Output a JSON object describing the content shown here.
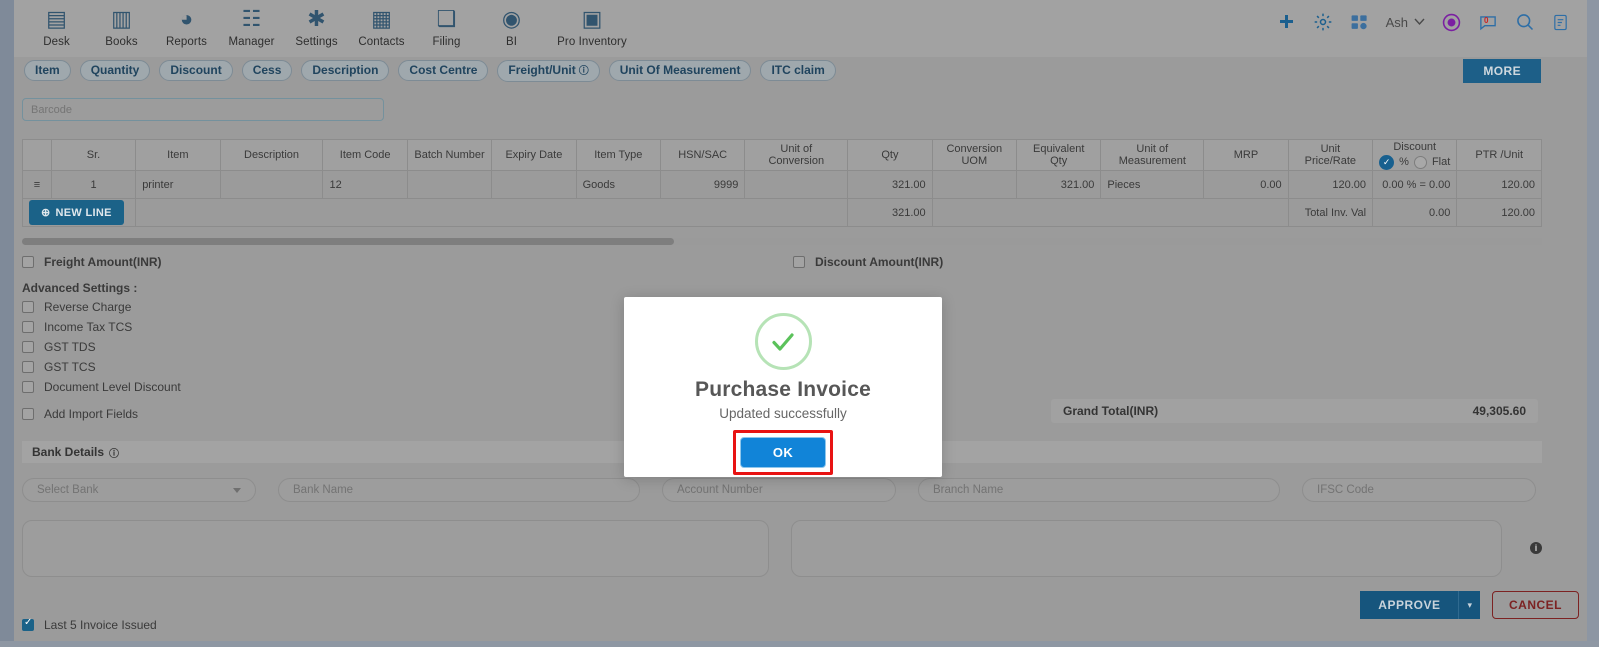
{
  "topnav": {
    "items": [
      {
        "label": "Desk",
        "icon": "desk-analytics-icon",
        "glyph": "▤"
      },
      {
        "label": "Books",
        "icon": "books-icon",
        "glyph": "▥"
      },
      {
        "label": "Reports",
        "icon": "reports-pie-icon",
        "glyph": "◕"
      },
      {
        "label": "Manager",
        "icon": "manager-people-icon",
        "glyph": "☷"
      },
      {
        "label": "Settings",
        "icon": "settings-tools-icon",
        "glyph": "✱"
      },
      {
        "label": "Contacts",
        "icon": "contacts-icon",
        "glyph": "▦"
      },
      {
        "label": "Filing",
        "icon": "filing-icon",
        "glyph": "❑"
      },
      {
        "label": "BI",
        "icon": "bi-icon",
        "glyph": "◉"
      },
      {
        "label": "Pro Inventory",
        "icon": "pro-inventory-icon",
        "glyph": "▣"
      }
    ],
    "right": {
      "add_icon": "plus-icon",
      "settings_icon": "gear-icon",
      "apps_icon": "apps-grid-icon",
      "user_label": "Ash",
      "chevron_icon": "chevron-down-icon",
      "badge_icon": "new-badge-icon",
      "messages_icon": "chat-bubble-icon",
      "messages_count": "0",
      "search_icon": "search-icon",
      "notes_icon": "notes-icon"
    }
  },
  "chips": [
    {
      "label": "Item"
    },
    {
      "label": "Quantity"
    },
    {
      "label": "Discount"
    },
    {
      "label": "Cess"
    },
    {
      "label": "Description"
    },
    {
      "label": "Cost Centre"
    },
    {
      "label": "Freight/Unit",
      "info": true
    },
    {
      "label": "Unit Of Measurement"
    },
    {
      "label": "ITC claim"
    }
  ],
  "more_button": "MORE",
  "barcode": {
    "placeholder": "Barcode",
    "value": ""
  },
  "grid": {
    "headers": [
      "",
      "Sr.",
      "Item",
      "Description",
      "Item Code",
      "Batch Number",
      "Expiry Date",
      "Item Type",
      "HSN/SAC",
      "Unit of Conversion",
      "Qty",
      "Conversion UOM",
      "Equivalent Qty",
      "Unit of Measurement",
      "MRP",
      "Unit Price/Rate",
      "Discount",
      "PTR /Unit"
    ],
    "discount_header": {
      "title": "Discount",
      "percent_label": "%",
      "flat_label": "Flat",
      "selected": "%"
    },
    "rows": [
      {
        "handle": "≡",
        "sr": "1",
        "item": "printer",
        "description": "",
        "item_code": "12",
        "batch_number": "",
        "expiry_date": "",
        "item_type": "Goods",
        "hsn_sac": "9999",
        "unit_of_conversion": "",
        "qty": "321.00",
        "conversion_uom": "",
        "equivalent_qty": "321.00",
        "unit_of_measurement": "Pieces",
        "mrp": "0.00",
        "unit_price_rate": "120.00",
        "discount": "0.00 % = 0.00",
        "ptr_unit": "120.00"
      }
    ],
    "new_line_button": "NEW LINE",
    "totals": {
      "qty": "321.00",
      "label": "Total Inv. Val",
      "discount": "0.00",
      "ptr_unit": "120.00"
    }
  },
  "options": {
    "freight_amount": {
      "label": "Freight Amount(INR)",
      "checked": false
    },
    "discount_amount": {
      "label": "Discount Amount(INR)",
      "checked": false
    },
    "advanced_title": "Advanced Settings :",
    "advanced": [
      {
        "label": "Reverse Charge",
        "checked": false
      },
      {
        "label": "Income Tax TCS",
        "checked": false
      },
      {
        "label": "GST TDS",
        "checked": false
      },
      {
        "label": "GST TCS",
        "checked": false
      },
      {
        "label": "Document Level Discount",
        "checked": false
      }
    ],
    "add_import_fields": {
      "label": "Add Import Fields",
      "checked": false
    }
  },
  "grand_total": {
    "label": "Grand Total(INR)",
    "value": "49,305.60"
  },
  "bank": {
    "section_title": "Bank Details",
    "info_icon": "info-icon",
    "select_bank_placeholder": "Select Bank",
    "bank_name_placeholder": "Bank Name",
    "account_number_placeholder": "Account Number",
    "branch_name_placeholder": "Branch Name",
    "ifsc_placeholder": "IFSC Code"
  },
  "notes": {
    "left_value": "",
    "right_value": "",
    "info_icon": "info-icon"
  },
  "footer": {
    "approve_label": "APPROVE",
    "approve_caret_icon": "chevron-down-icon",
    "cancel_label": "CANCEL",
    "last5": {
      "label": "Last 5 Invoice Issued",
      "checked": true
    }
  },
  "modal": {
    "success_icon": "check-circle-icon",
    "title": "Purchase Invoice",
    "subtitle": "Updated successfully",
    "ok_label": "OK",
    "highlight_color": "#e81313",
    "button_color": "#1184d8",
    "check_color": "#5bc25b"
  }
}
